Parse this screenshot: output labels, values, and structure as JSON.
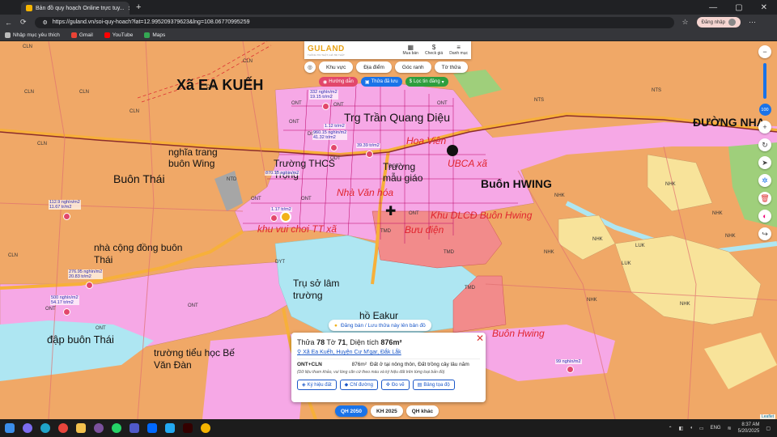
{
  "browser": {
    "tab_title": "Bản đồ quy hoạch Online trực tuy...",
    "url": "https://guland.vn/soi-quy-hoach?lat=12.995209379623&lng=108.06770995259",
    "login_label": "Đăng nhập",
    "bookmarks": [
      {
        "label": "Nhập mục yêu thích",
        "color": "#bbb"
      },
      {
        "label": "Gmail",
        "color": "#ea4335"
      },
      {
        "label": "YouTube",
        "color": "#ff0000"
      },
      {
        "label": "Maps",
        "color": "#34a853"
      }
    ]
  },
  "app": {
    "logo": "GULAND",
    "logo_tagline": "THÔNG TIN THẬT, GIÁ TRỊ THẬT",
    "top_actions": [
      {
        "icon": "building-icon",
        "glyph": "▦",
        "label": "Mua bán"
      },
      {
        "icon": "dollar-icon",
        "glyph": "$",
        "label": "Check giá"
      },
      {
        "icon": "menu-icon",
        "glyph": "≡",
        "label": "Danh mục"
      }
    ],
    "filters": [
      "Khu vực",
      "Địa điểm",
      "Góc ranh",
      "Tờ thửa"
    ],
    "chips": [
      {
        "label": "Hướng dẫn",
        "color": "#e2476b"
      },
      {
        "label": "Thửa đã lưu",
        "color": "#1a73e8"
      },
      {
        "label": "Lọc tin đăng",
        "color": "#2e9e3e"
      }
    ],
    "zoom_level": "100",
    "save_prompt": "Đăng bán / Lưu thửa này lên bản đồ"
  },
  "map": {
    "places": [
      {
        "text": "Xã EA KUẾH",
        "style": "big"
      },
      {
        "text": "Buôn Thái",
        "style": "med"
      },
      {
        "text": "Buôn HWING",
        "style": "med"
      },
      {
        "text": "ĐƯỜNG NHA",
        "style": "med"
      },
      {
        "text": "Trg Trần Quang Diệu",
        "style": "med"
      },
      {
        "text": "nghĩa trang buôn Wing",
        "style": "med"
      },
      {
        "text": "Trường THCS Trọng",
        "style": "med"
      },
      {
        "text": "Trường mẫu giáo",
        "style": "med"
      },
      {
        "text": "nhà cộng đồng buôn Thái",
        "style": "med"
      },
      {
        "text": "Trụ sở lâm trường",
        "style": "med"
      },
      {
        "text": "đập buôn Thái",
        "style": "med"
      },
      {
        "text": "trường tiểu học Bế Văn Đàn",
        "style": "med"
      },
      {
        "text": "hồ Eakur",
        "style": "med"
      },
      {
        "text": "Hoa Viên",
        "style": "red"
      },
      {
        "text": "UBCA xã",
        "style": "red"
      },
      {
        "text": "Nhà Văn hóa",
        "style": "red"
      },
      {
        "text": "khu vui chơi TT xã",
        "style": "red"
      },
      {
        "text": "Bưu điện",
        "style": "red"
      },
      {
        "text": "Khu DLCĐ Buôn Hwing",
        "style": "red"
      },
      {
        "text": "Buôn Hwing",
        "style": "red"
      }
    ],
    "land_codes": [
      "CLN",
      "ONT",
      "NHK",
      "NTD",
      "LUK",
      "DGT",
      "TMD",
      "NTS",
      "DYT",
      "ODT"
    ],
    "price_tags": [
      {
        "text": "332 nghìn/m2\n19.15 tr/m2"
      },
      {
        "text": "1.12 tr/m2"
      },
      {
        "text": "960.15 nghìn/m2\n41.32 tr/m2"
      },
      {
        "text": "39.39 tr/m2"
      },
      {
        "text": "870.15 nghìn/m2"
      },
      {
        "text": "1.17 tr/m2"
      },
      {
        "text": "112.9 nghìn/m2\n11.67 tr/m2"
      },
      {
        "text": "276.95 nghìn/m2\n20.83 tr/m2"
      },
      {
        "text": "500 nghìn/m2\n54.17 tr/m2"
      },
      {
        "text": "99 nghìn/m2"
      }
    ]
  },
  "parcel_card": {
    "title_prefix": "Thửa",
    "parcel_no": "78",
    "sheet_prefix": "Tờ",
    "sheet_no": "71",
    "area_prefix": "Diện tích",
    "area": "876m²",
    "location": "Xã Ea Kuếh, Huyện Cư M'gar, Đắk Lắk",
    "land_type": "ONT+CLN",
    "land_area": "876m²",
    "land_desc": "Đất ở tại nông thôn, Đất trồng cây lâu năm",
    "note": "(Dữ liệu tham khảo, vui lòng căn cứ theo màu và ký hiệu đất trên từng loại bản đồ)",
    "buttons": [
      "Ký hiệu đất",
      "Chỉ đường",
      "Đo vẽ",
      "Bảng tọa độ"
    ]
  },
  "plan_tabs": [
    {
      "label": "QH 2050",
      "active": true
    },
    {
      "label": "KH 2025",
      "active": false
    },
    {
      "label": "QH khác",
      "active": false
    }
  ],
  "attribution": "Leaflet",
  "taskbar": {
    "lang": "ENG",
    "time": "8:37 AM",
    "date": "5/20/2025"
  }
}
